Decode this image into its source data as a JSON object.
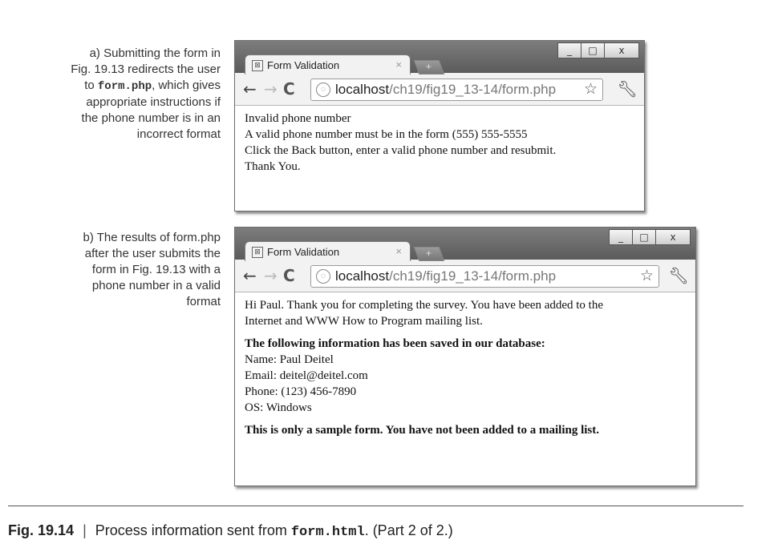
{
  "caption_a": {
    "line1": "a) Submitting the form in",
    "line2": "Fig. 19.13 redirects the user",
    "line3_pre": "to ",
    "line3_code": "form.php",
    "line3_post": ", which gives",
    "line4": "appropriate instructions if",
    "line5": "the phone number is in an",
    "line6": "incorrect format"
  },
  "caption_b": {
    "line1": "b) The results of form.php",
    "line2": "after the user submits the",
    "line3": "form in Fig. 19.13 with a",
    "line4": "phone number in a valid",
    "line5": "format"
  },
  "browser_a": {
    "tab_title": "Form Validation",
    "tab_close": "×",
    "new_tab": "+",
    "minimize": "_",
    "maximize": "□",
    "close": "x",
    "url_host": "localhost",
    "url_path": "/ch19/fig19_13-14/form.php",
    "content": [
      "Invalid phone number",
      "A valid phone number must be in the form (555) 555-5555",
      "Click the Back button, enter a valid phone number and resubmit.",
      "Thank You."
    ]
  },
  "browser_b": {
    "tab_title": "Form Validation",
    "tab_close": "×",
    "new_tab": "+",
    "minimize": "_",
    "maximize": "□",
    "close": "x",
    "url_host": "localhost",
    "url_path": "/ch19/fig19_13-14/form.php",
    "intro_1": "Hi Paul. Thank you for completing the survey. You have been added to the",
    "intro_2": "Internet and WWW How to Program mailing list.",
    "saved_heading": "The following information has been saved in our database:",
    "name": "Name: Paul Deitel",
    "email": "Email: deitel@deitel.com",
    "phone": "Phone: (123) 456-7890",
    "os": "OS: Windows",
    "notice": "This is only a sample form. You have not been added to a mailing list."
  },
  "figure": {
    "number": "Fig. 19.14",
    "separator": "|",
    "text_pre": "Process information sent from ",
    "text_code": "form.html",
    "text_post": ". (Part 2 of 2.)"
  },
  "icons": {
    "back": "back-arrow-icon",
    "forward": "forward-arrow-icon",
    "reload": "reload-icon",
    "globe": "page-globe-icon",
    "star": "bookmark-star-icon",
    "wrench": "wrench-icon",
    "favicon": "page-favicon-icon"
  }
}
